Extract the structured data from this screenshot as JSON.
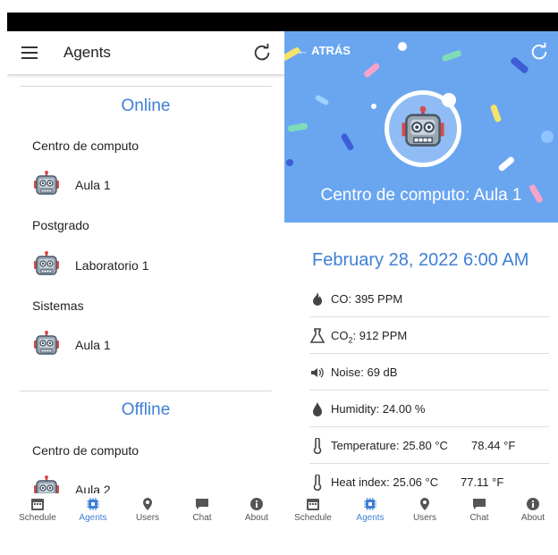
{
  "left": {
    "title": "Agents",
    "online": {
      "heading": "Online",
      "groups": [
        {
          "name": "Centro de computo",
          "agents": [
            "Aula 1"
          ]
        },
        {
          "name": "Postgrado",
          "agents": [
            "Laboratorio 1"
          ]
        },
        {
          "name": "Sistemas",
          "agents": [
            "Aula 1"
          ]
        }
      ]
    },
    "offline": {
      "heading": "Offline",
      "groups": [
        {
          "name": "Centro de computo",
          "agents": [
            "Aula 2"
          ]
        }
      ]
    }
  },
  "right": {
    "back_label": "ATRÁS",
    "hero_title": "Centro de computo: Aula 1",
    "date": "February 28, 2022 6:00 AM",
    "readings": {
      "co": "CO: 395 PPM",
      "co2_prefix": "CO",
      "co2_sub": "2",
      "co2_value": ": 912 PPM",
      "noise": "Noise: 69 dB",
      "humidity": "Humidity: 24.00 %",
      "temperature_c": "Temperature: 25.80 °C",
      "temperature_f": "78.44 °F",
      "heat_index_c": "Heat index: 25.06 °C",
      "heat_index_f": "77.11 °F"
    }
  },
  "nav": {
    "schedule": "Schedule",
    "agents": "Agents",
    "users": "Users",
    "chat": "Chat",
    "about": "About"
  },
  "colors": {
    "accent": "#3f7fd6",
    "hero_bg": "#6aa6f0"
  }
}
